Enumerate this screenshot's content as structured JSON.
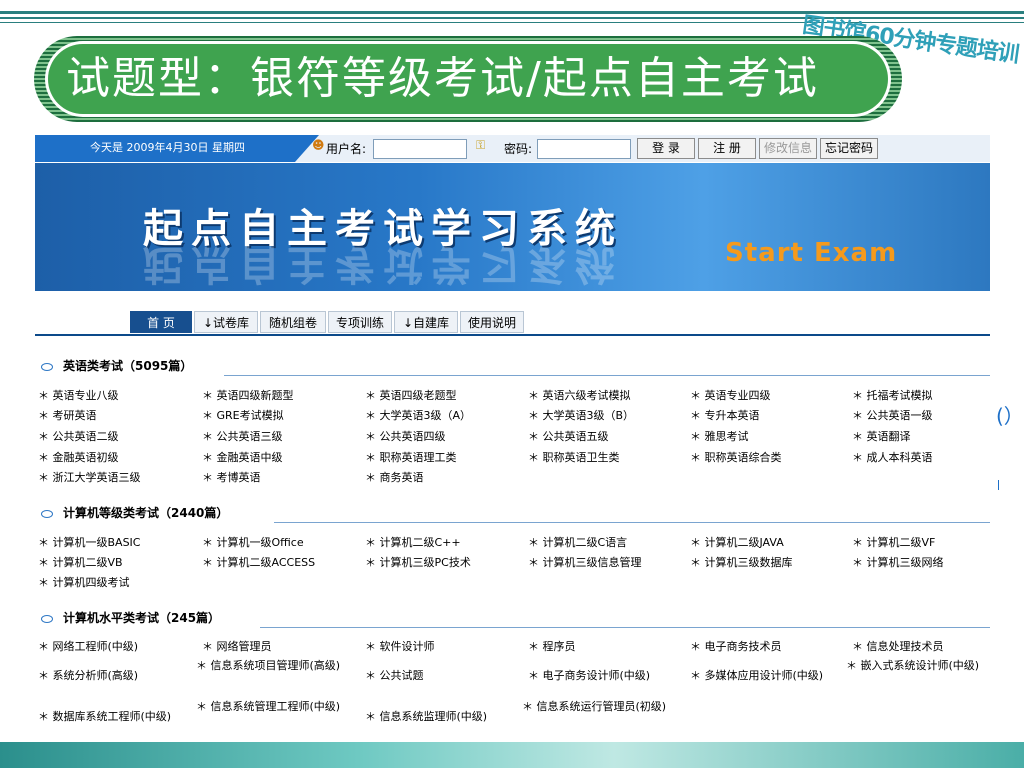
{
  "slide": {
    "watermark": "图书馆60分钟专题培训",
    "title": "试题型：银符等级考试/起点自主考试"
  },
  "loginbar": {
    "date": "今天是 2009年4月30日 星期四",
    "username_label": "用户名:",
    "password_label": "密码:",
    "login_btn": "登 录",
    "register_btn": "注 册",
    "modify_btn": "修改信息",
    "forgot_btn": "忘记密码"
  },
  "banner": {
    "title": "起点自主考试学习系统",
    "subtitle": "Start   Exam"
  },
  "nav": {
    "tabs": [
      "首 页",
      "↓试卷库",
      "随机组卷",
      "专项训练",
      "↓自建库",
      "使用说明"
    ]
  },
  "categories": [
    {
      "name": "英语类考试（5095篇）",
      "items": [
        "英语专业八级",
        "英语四级新题型",
        "英语四级老题型",
        "英语六级考试模拟",
        "英语专业四级",
        "托福考试模拟",
        "考研英语",
        "GRE考试模拟",
        "大学英语3级（A）",
        "大学英语3级（B）",
        "专升本英语",
        "公共英语一级",
        "公共英语二级",
        "公共英语三级",
        "公共英语四级",
        "公共英语五级",
        "雅思考试",
        "英语翻译",
        "金融英语初级",
        "金融英语中级",
        "职称英语理工类",
        "职称英语卫生类",
        "职称英语综合类",
        "成人本科英语",
        "浙江大学英语三级",
        "考博英语",
        "商务英语"
      ]
    },
    {
      "name": "计算机等级类考试（2440篇）",
      "items": [
        "计算机一级BASIC",
        "计算机一级Office",
        "计算机二级C++",
        "计算机二级C语言",
        "计算机二级JAVA",
        "计算机二级VF",
        "计算机二级VB",
        "计算机二级ACCESS",
        "计算机三级PC技术",
        "计算机三级信息管理",
        "计算机三级数据库",
        "计算机三级网络",
        "计算机四级考试"
      ]
    },
    {
      "name": "计算机水平类考试（245篇）",
      "items": [
        "网络工程师(中级)",
        "网络管理员",
        "软件设计师",
        "程序员",
        "电子商务技术员",
        "信息处理技术员",
        "系统分析师(高级)",
        "信息系统项目管理师(高级)",
        "公共试题",
        "电子商务设计师(中级)",
        "多媒体应用设计师(中级)",
        "嵌入式系统设计师(中级)",
        "数据库系统工程师(中级)",
        "信息系统管理工程师(中级)",
        "信息系统监理师(中级)",
        "信息系统运行管理员(初级)"
      ]
    }
  ],
  "edge": {
    "right_glyph": "(）"
  }
}
